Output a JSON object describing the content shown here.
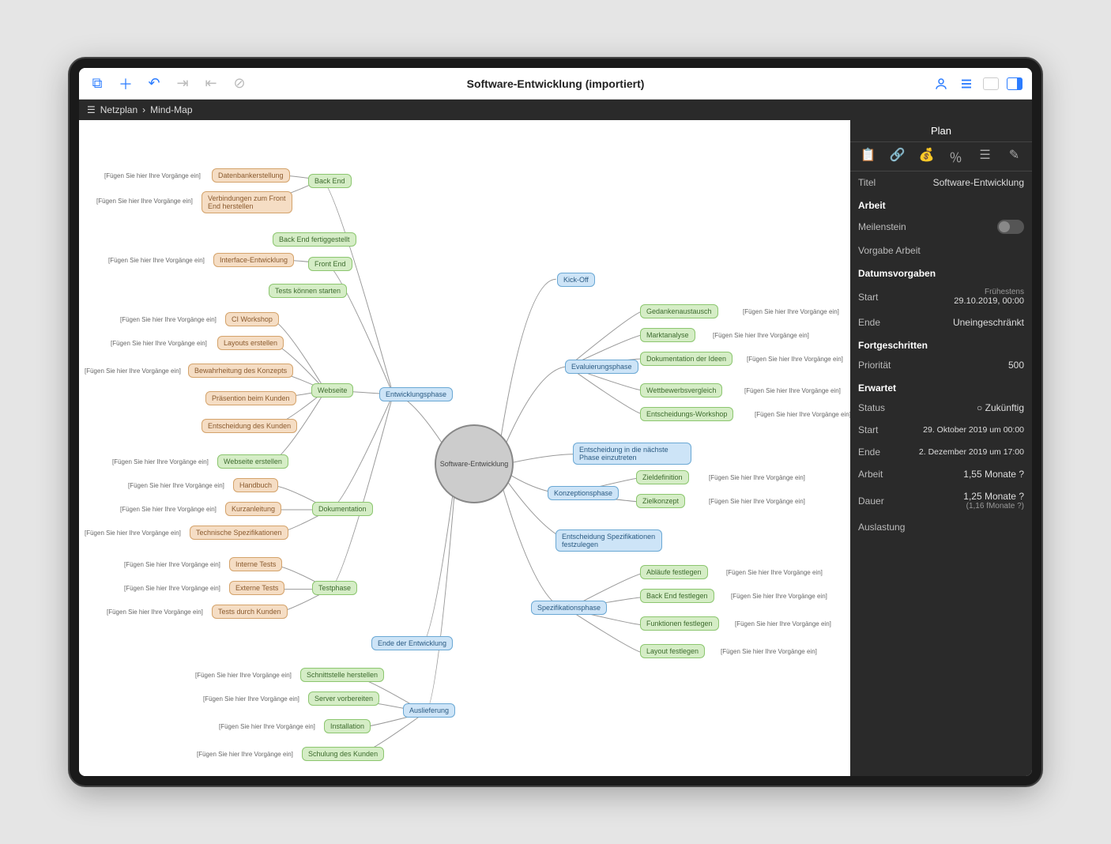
{
  "title": "Software-Entwicklung (importiert)",
  "breadcrumb": {
    "item1": "Netzplan",
    "item2": "Mind-Map"
  },
  "sidebar": {
    "header": "Plan",
    "titel_label": "Titel",
    "titel_value": "Software-Entwicklung",
    "arbeit_section": "Arbeit",
    "meilenstein": "Meilenstein",
    "vorgabe_arbeit": "Vorgabe Arbeit",
    "datum_section": "Datumsvorgaben",
    "start_label": "Start",
    "start_sub": "Frühestens",
    "start_value": "29.10.2019, 00:00",
    "ende_label": "Ende",
    "ende_value": "Uneingeschränkt",
    "fortg_section": "Fortgeschritten",
    "prio_label": "Priorität",
    "prio_value": "500",
    "erwartet_section": "Erwartet",
    "status_label": "Status",
    "status_value": "Zukünftig",
    "exp_start_label": "Start",
    "exp_start_value": "29. Oktober 2019 um 00:00",
    "exp_ende_label": "Ende",
    "exp_ende_value": "2. Dezember 2019 um 17:00",
    "exp_arbeit_label": "Arbeit",
    "exp_arbeit_value": "1,55 Monate ?",
    "exp_dauer_label": "Dauer",
    "exp_dauer_value": "1,25 Monate ?",
    "exp_dauer_sub": "(1,16 fMonate ?)",
    "auslastung": "Auslastung"
  },
  "center": "Software-Entwicklung",
  "placeholder": "[Fügen Sie hier Ihre Vorgänge ein]",
  "nodes": {
    "kickoff": "Kick-Off",
    "eval": "Evaluierungsphase",
    "gedanken": "Gedankenaustausch",
    "markt": "Marktanalyse",
    "doku_ideen": "Dokumentation der Ideen",
    "wettbewerb": "Wettbewerbsvergleich",
    "workshop": "Entscheidungs-Workshop",
    "entscheidung_phase": "Entscheidung in die nächste Phase einzutreten",
    "konzeption": "Konzeptionsphase",
    "zieldef": "Zieldefinition",
    "zielkonzept": "Zielkonzept",
    "entscheidung_spez": "Entscheidung Spezifikationen festzulegen",
    "spezifikation": "Spezifikationsphase",
    "ablaufe": "Abläufe festlegen",
    "backend_fest": "Back End festlegen",
    "funktionen": "Funktionen festlegen",
    "layout_fest": "Layout festlegen",
    "entwicklung": "Entwicklungsphase",
    "backend": "Back End",
    "db_erstellung": "Datenbankerstellung",
    "verb_frontend": "Verbindungen zum Front End herstellen",
    "backend_fertig": "Back End fertiggestellt",
    "frontend": "Front End",
    "interface": "Interface-Entwicklung",
    "tests_start": "Tests können starten",
    "webseite": "Webseite",
    "ci_workshop": "CI Workshop",
    "layouts": "Layouts erstellen",
    "bewahrung": "Bewahrheitung des Konzepts",
    "praesi": "Präsention beim Kunden",
    "kunde_ent": "Entscheidung des Kunden",
    "webseite_erst": "Webseite erstellen",
    "dokumentation": "Dokumentation",
    "handbuch": "Handbuch",
    "kurzanleitung": "Kurzanleitung",
    "techspez": "Technische Spezifikationen",
    "testphase": "Testphase",
    "intern": "Interne Tests",
    "extern": "Externe Tests",
    "tests_kunden": "Tests durch Kunden",
    "ende_entw": "Ende der Entwicklung",
    "auslieferung": "Auslieferung",
    "schnittstelle": "Schnittstelle herstellen",
    "server": "Server vorbereiten",
    "installation": "Installation",
    "schulung": "Schulung des Kunden"
  }
}
